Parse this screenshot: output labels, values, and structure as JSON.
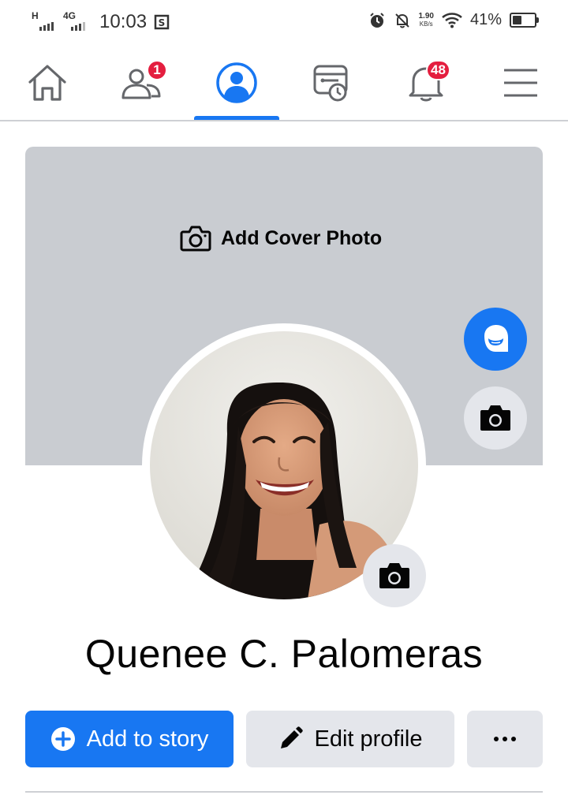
{
  "status_bar": {
    "network_1": "H",
    "network_2": "4G",
    "time": "10:03",
    "speed_value": "1.90",
    "speed_unit": "KB/s",
    "battery_percent": "41%",
    "battery_level": 0.41,
    "icons": [
      "signal-icon",
      "screenshot-icon",
      "alarm-icon",
      "mute-bell-icon",
      "wifi-icon",
      "battery-icon"
    ]
  },
  "nav": {
    "items": [
      {
        "name": "home",
        "icon": "home-icon"
      },
      {
        "name": "friends",
        "icon": "friends-icon",
        "badge": "1"
      },
      {
        "name": "profile",
        "icon": "profile-icon",
        "active": true
      },
      {
        "name": "watch",
        "icon": "watch-feed-icon"
      },
      {
        "name": "notifications",
        "icon": "bell-icon",
        "badge": "48"
      },
      {
        "name": "menu",
        "icon": "hamburger-menu-icon"
      }
    ],
    "accent_color": "#1877f2",
    "badge_color": "#e41e3f"
  },
  "cover": {
    "add_cover_label": "Add Cover Photo",
    "background_color": "#c9ccd1"
  },
  "profile": {
    "name": "Quenee C. Palomeras"
  },
  "actions": {
    "add_story_label": "Add to story",
    "edit_profile_label": "Edit profile",
    "more_label": "..."
  }
}
